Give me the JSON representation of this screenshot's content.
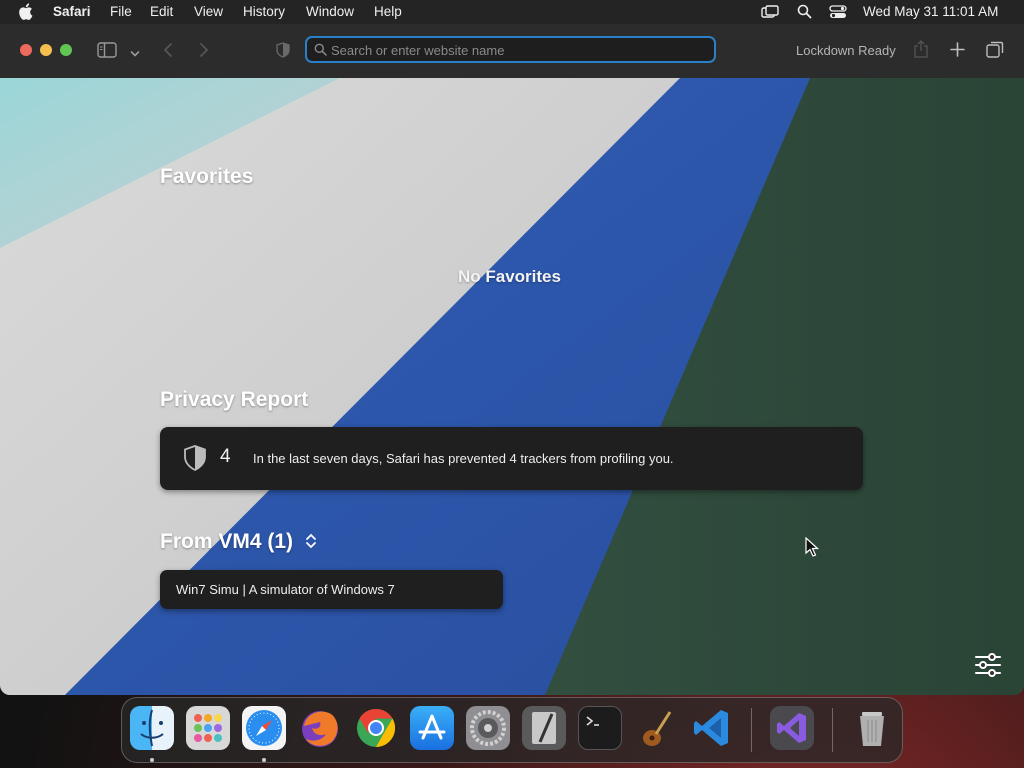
{
  "menubar": {
    "app_name": "Safari",
    "menus": [
      "File",
      "Edit",
      "View",
      "History",
      "Window",
      "Help"
    ],
    "clock": "Wed May 31  11:01 AM",
    "status_icons": [
      "screen-mirroring-icon",
      "spotlight-search-icon",
      "control-center-icon"
    ]
  },
  "toolbar": {
    "search_placeholder": "Search or enter website name",
    "lockdown_label": "Lockdown Ready",
    "accent_color": "#2a80c8"
  },
  "start_page": {
    "favorites_heading": "Favorites",
    "no_favorites": "No Favorites",
    "privacy_heading": "Privacy Report",
    "privacy_count": "4",
    "privacy_text": "In the last seven days, Safari has prevented 4 trackers from profiling you.",
    "from_device_heading": "From VM4 (1)",
    "from_device_tab": "Win7 Simu | A simulator of Windows 7"
  },
  "dock": {
    "apps": [
      "Finder",
      "Launchpad",
      "Safari",
      "Firefox",
      "Chrome",
      "App Store",
      "System Settings",
      "Script Editor",
      "Terminal",
      "Instruments",
      "Visual Studio Code",
      "Visual Studio",
      "Trash"
    ],
    "running": [
      "Finder",
      "Safari"
    ]
  }
}
